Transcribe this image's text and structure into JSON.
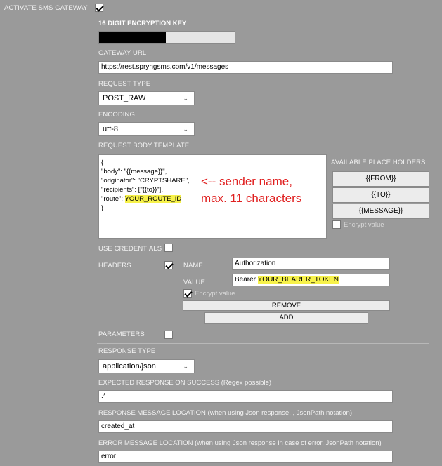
{
  "gateway": {
    "activate_label": "ACTIVATE SMS GATEWAY",
    "activate_checked": true
  },
  "encryption": {
    "label": "16 DIGIT ENCRYPTION KEY"
  },
  "gateway_url": {
    "label": "GATEWAY URL",
    "value": "https://rest.spryngsms.com/v1/messages"
  },
  "request_type": {
    "label": "REQUEST TYPE",
    "value": "POST_RAW"
  },
  "encoding": {
    "label": "ENCODING",
    "value": "utf-8"
  },
  "template": {
    "label": "REQUEST BODY TEMPLATE",
    "lines": [
      "{",
      " \"body\": \"{{message}}\",",
      " \"originator\": \"CRYPTSHARE\",",
      " \"recipients\": [\"{{to}}\"],",
      " \"route\": "
    ],
    "route_value": "YOUR_ROUTE_ID",
    "closing": "}",
    "annotation_line1": "<-- sender name,",
    "annotation_line2": "max. 11 characters"
  },
  "placeholders": {
    "label": "AVAILABLE PLACE HOLDERS",
    "items": [
      "{{FROM}}",
      "{{TO}}",
      "{{MESSAGE}}"
    ],
    "encrypt_label": "Encrypt value"
  },
  "credentials": {
    "label": "USE CREDENTIALS"
  },
  "headers": {
    "label": "HEADERS",
    "name_label": "NAME",
    "name_value": "Authorization",
    "value_label": "VALUE",
    "value_prefix": "Bearer ",
    "value_token": "YOUR_BEARER_TOKEN",
    "encrypt_label": "Encrypt value",
    "remove_label": "REMOVE",
    "add_label": "ADD"
  },
  "parameters": {
    "label": "PARAMETERS"
  },
  "response_type": {
    "label": "RESPONSE TYPE",
    "value": "application/json"
  },
  "expected_response": {
    "label": "EXPECTED RESPONSE ON SUCCESS (Regex possible)",
    "value": ".*"
  },
  "response_location": {
    "label": "RESPONSE MESSAGE LOCATION (when using Json response, , JsonPath notation)",
    "value": "created_at"
  },
  "error_location": {
    "label": "ERROR MESSAGE LOCATION (when using Json response in case of error, JsonPath notation)",
    "value": "error"
  }
}
